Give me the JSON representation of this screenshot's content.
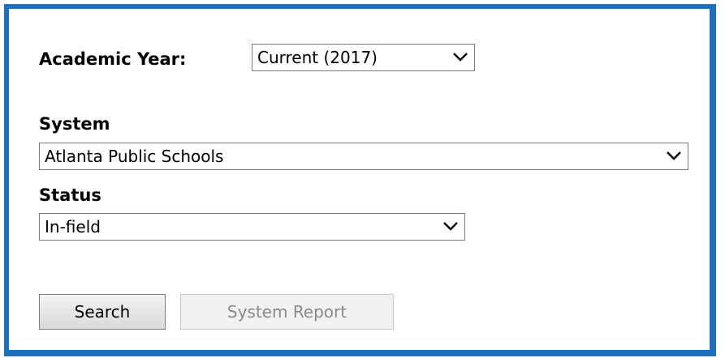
{
  "academic_year": {
    "label": "Academic Year:",
    "selected": "Current (2017)"
  },
  "system": {
    "label": "System",
    "selected": "Atlanta Public Schools"
  },
  "status": {
    "label": "Status",
    "selected": "In-field"
  },
  "buttons": {
    "search": "Search",
    "system_report": "System Report"
  },
  "icons": {
    "dropdown": "chevron-down-icon"
  },
  "colors": {
    "frame_border": "#1f6fbf",
    "disabled_text": "#8a8a8a"
  }
}
